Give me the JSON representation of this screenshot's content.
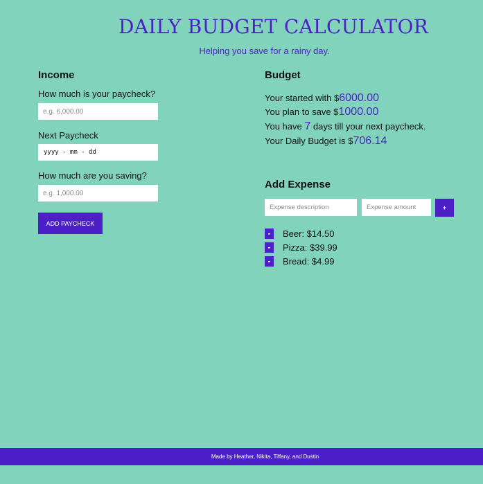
{
  "header": {
    "title": "DAILY BUDGET CALCULATOR",
    "subtitle": "Helping you save for a rainy day."
  },
  "income": {
    "heading": "Income",
    "paycheck_label": "How much is your paycheck?",
    "paycheck_placeholder": "e.g. 6,000.00",
    "next_paycheck_label": "Next Paycheck",
    "next_paycheck_value": "yyyy - mm - dd",
    "saving_label": "How much are you saving?",
    "saving_placeholder": "e.g. 1,000.00",
    "add_button": "ADD PAYCHECK"
  },
  "budget": {
    "heading": "Budget",
    "started_prefix": "Your started with $",
    "started_value": "6000.00",
    "save_prefix": "You plan to save $",
    "save_value": "1000.00",
    "days_prefix": "You have ",
    "days_value": "7",
    "days_suffix": " days till your next paycheck.",
    "daily_prefix": "Your Daily Budget is $",
    "daily_value": "706.14"
  },
  "expenses": {
    "heading": "Add Expense",
    "description_placeholder": "Expense description",
    "amount_placeholder": "Expense amount",
    "add_button": "+",
    "remove_button": "-",
    "items": [
      {
        "label": "Beer: $14.50"
      },
      {
        "label": "Pizza: $39.99"
      },
      {
        "label": "Bread: $4.99"
      }
    ]
  },
  "footer": {
    "text": "Made by Heather, Nikita, Tiffany, and Dustin"
  },
  "colors": {
    "background": "#81d3bc",
    "accent": "#4c1fc7"
  }
}
